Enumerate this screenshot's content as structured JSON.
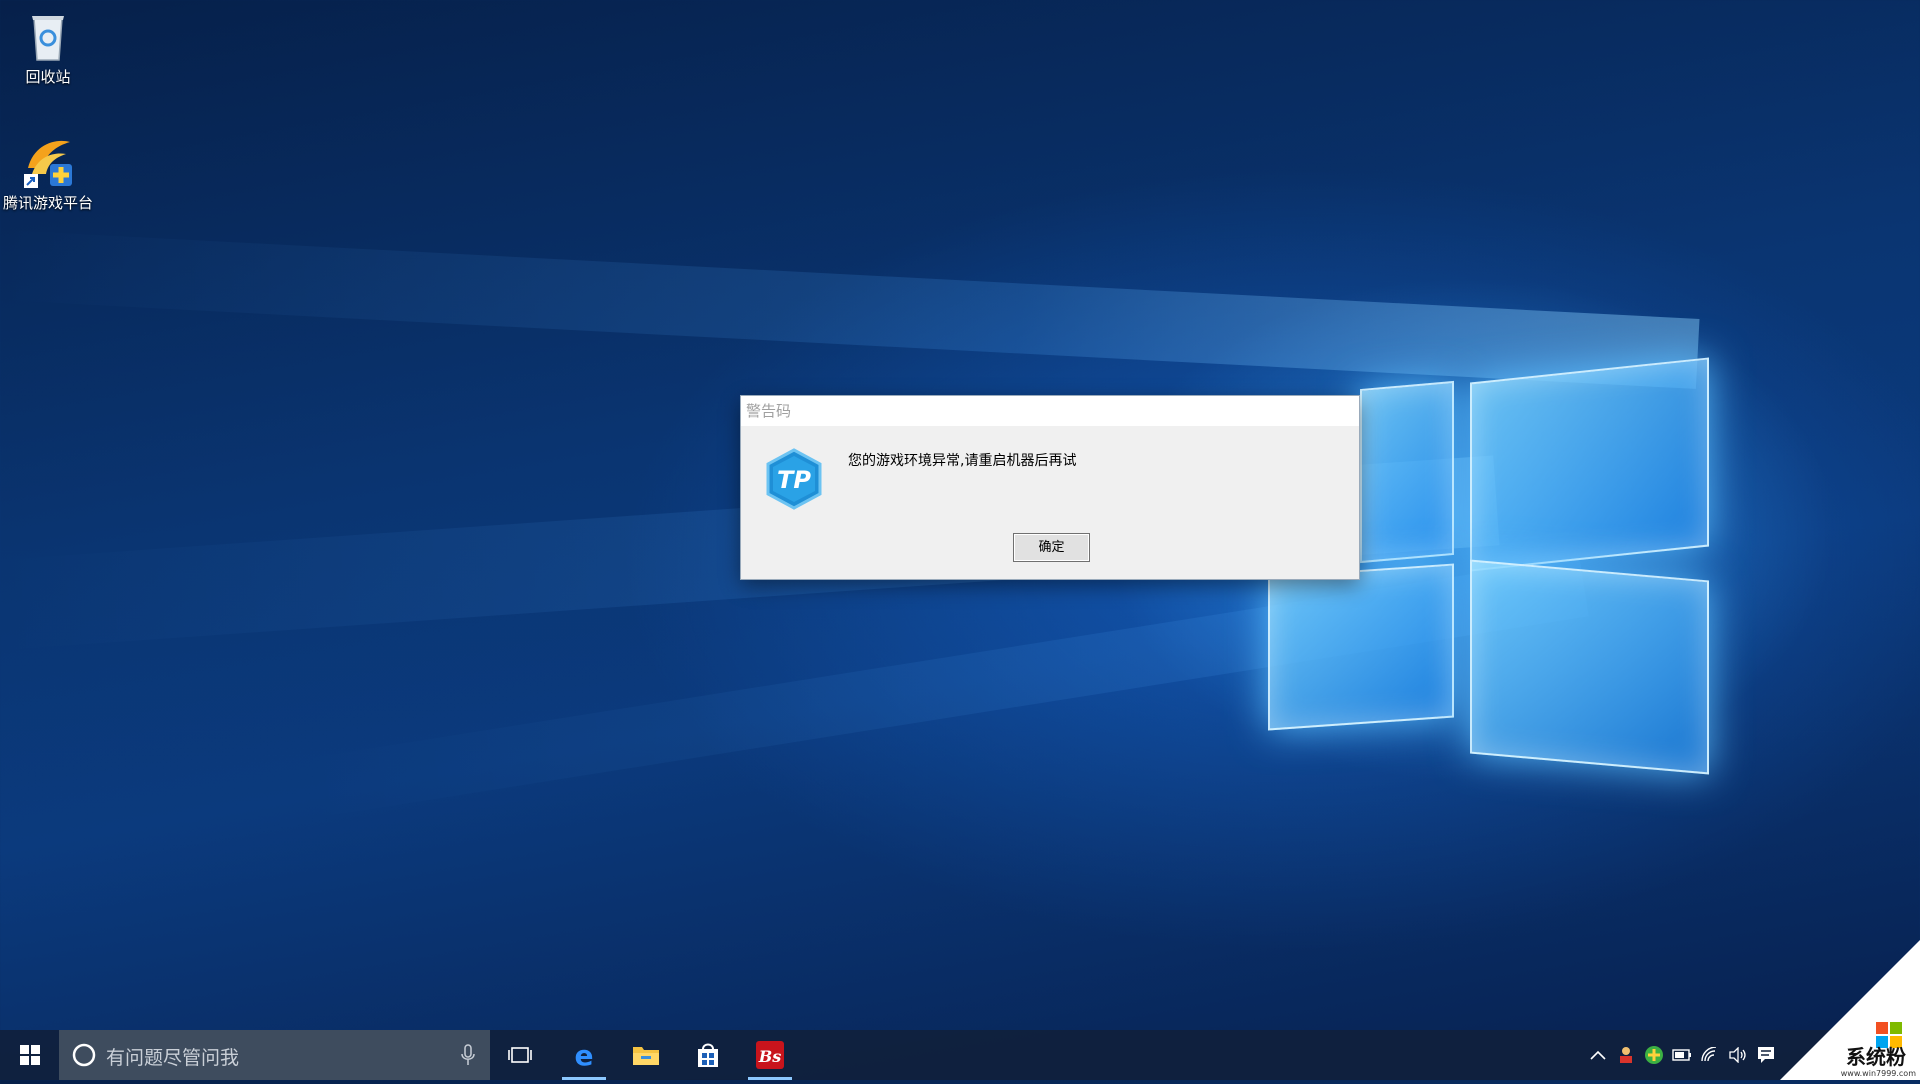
{
  "desktop": {
    "icons": [
      {
        "label": "回收站"
      },
      {
        "label": "腾讯游戏平台"
      }
    ]
  },
  "dialog": {
    "title": "警告码",
    "message": "您的游戏环境异常,请重启机器后再试",
    "ok_label": "确定"
  },
  "taskbar": {
    "search_placeholder": "有问题尽管问我"
  },
  "watermark": {
    "brand": "系统粉",
    "url": "www.win7999.com"
  },
  "colors": {
    "taskbar": "#10203c",
    "search_bg": "#3e4c5e",
    "dialog_bg": "#f0f0f0",
    "accent": "#2f8fff"
  }
}
